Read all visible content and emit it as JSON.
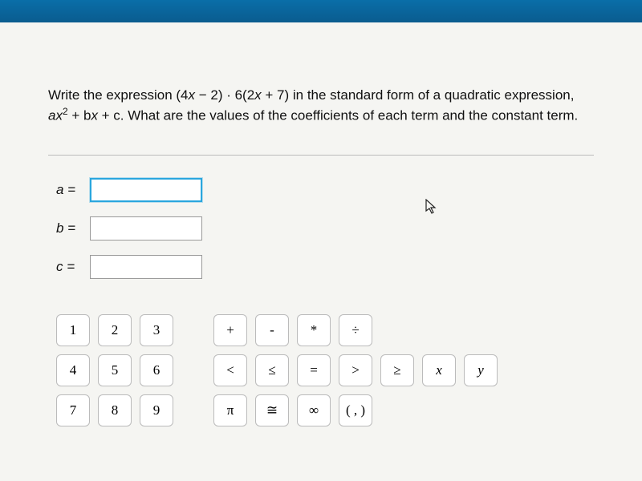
{
  "question": {
    "line1_pre": "Write the expression (4",
    "line1_var1": "x",
    "line1_mid1": " − 2) · 6(2",
    "line1_var2": "x",
    "line1_mid2": " + 7) in the standard form of a quadratic expression,",
    "line2_pre": "a",
    "line2_var1": "x",
    "line2_sup": "2",
    "line2_mid1": " + b",
    "line2_var2": "x",
    "line2_mid2": " + c. What are the values of the coefficients of each term and the constant term."
  },
  "answers": {
    "a": {
      "label": "a =",
      "value": ""
    },
    "b": {
      "label": "b =",
      "value": ""
    },
    "c": {
      "label": "c =",
      "value": ""
    }
  },
  "keypad": {
    "row1": [
      "1",
      "2",
      "3"
    ],
    "row2": [
      "4",
      "5",
      "6"
    ],
    "row3": [
      "7",
      "8",
      "9"
    ]
  },
  "ops": {
    "row1": [
      "+",
      "-",
      "*",
      "÷",
      "",
      "",
      "",
      ""
    ],
    "row2": [
      "<",
      "≤",
      "=",
      ">",
      "≥",
      "x",
      "y",
      ""
    ],
    "row3": [
      "π",
      "≅",
      "∞",
      "( , )",
      "",
      "",
      "",
      ""
    ]
  }
}
